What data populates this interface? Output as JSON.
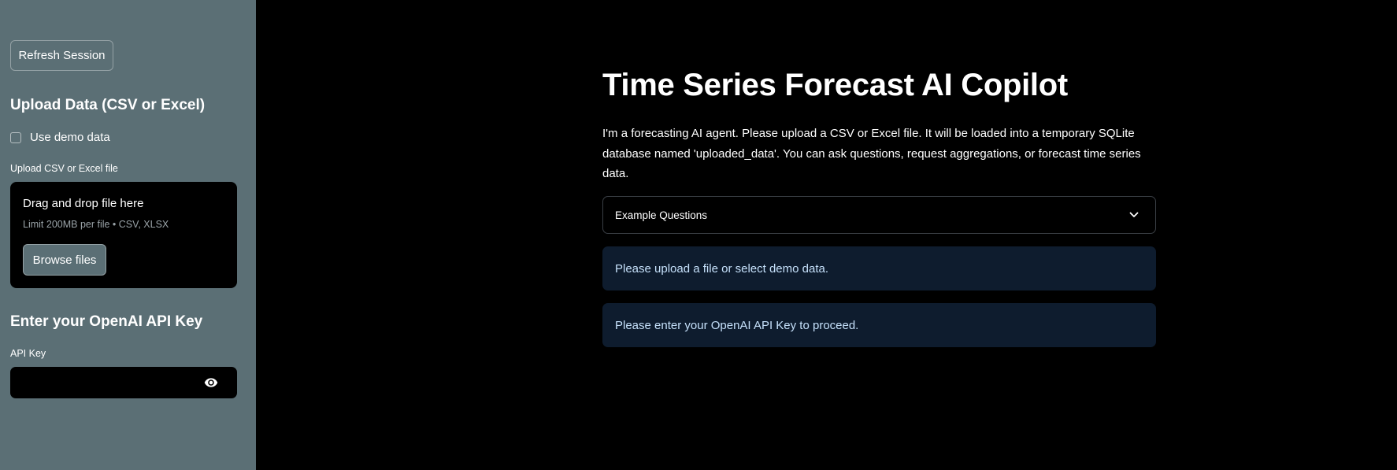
{
  "sidebar": {
    "refresh_button": "Refresh Session",
    "upload_heading": "Upload Data (CSV or Excel)",
    "demo_checkbox_label": "Use demo data",
    "demo_checked": false,
    "uploader_label": "Upload CSV or Excel file",
    "dropzone_title": "Drag and drop file here",
    "dropzone_limit": "Limit 200MB per file • CSV, XLSX",
    "browse_button": "Browse files",
    "api_heading": "Enter your OpenAI API Key",
    "api_label": "API Key",
    "api_value": "",
    "eye_icon": "eye-icon"
  },
  "main": {
    "title": "Time Series Forecast AI Copilot",
    "intro": "I'm a forecasting AI agent. Please upload a CSV or Excel file. It will be loaded into a temporary SQLite database named 'uploaded_data'. You can ask questions, request aggregations, or forecast time series data.",
    "expander_label": "Example Questions",
    "info_upload": "Please upload a file or select demo data.",
    "info_api_key": "Please enter your OpenAI API Key to proceed."
  },
  "colors": {
    "sidebar_bg": "#5b6f75",
    "main_bg": "#000000",
    "info_bg": "#0e1c2e",
    "info_text": "#c5e0fa"
  }
}
